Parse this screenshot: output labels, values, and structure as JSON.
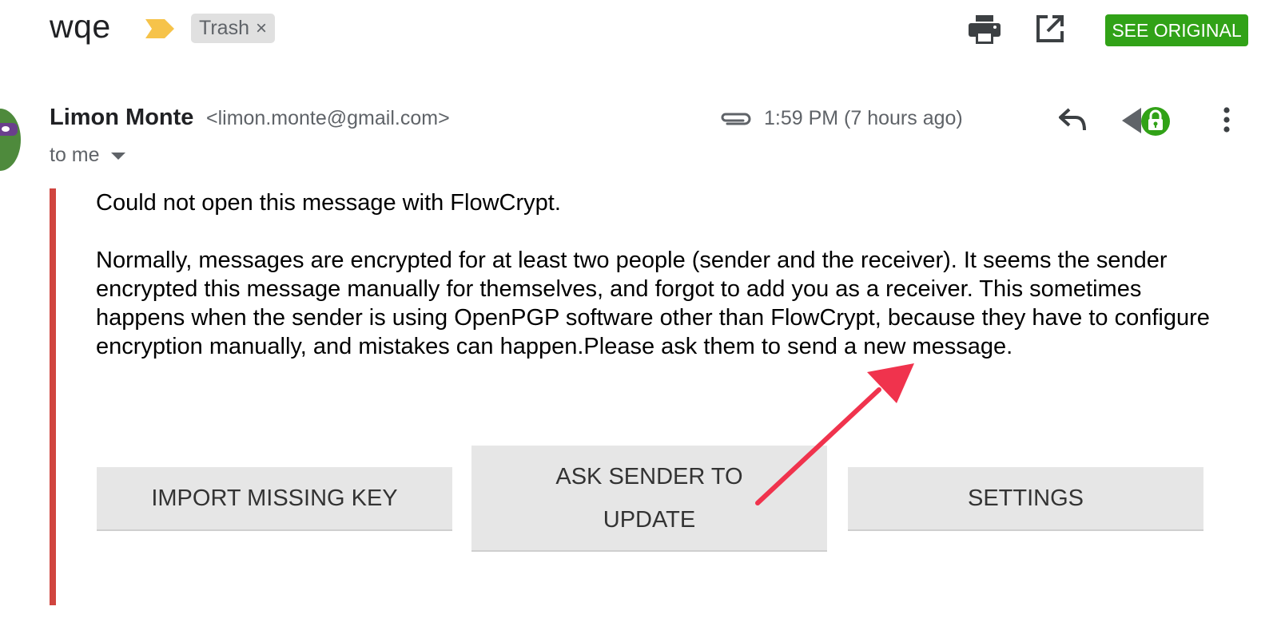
{
  "header": {
    "subject": "wqe",
    "label_chip": "Trash",
    "label_remove": "×",
    "see_original": "SEE ORIGINAL",
    "icons": [
      "importance-marker-icon",
      "print-icon",
      "open-in-new-window-icon"
    ],
    "colors": {
      "see_original_bg": "#31a217",
      "importance": "#f6c34a"
    }
  },
  "sender": {
    "name": "Limon Monte",
    "email": "<limon.monte@gmail.com>",
    "recipient": "to me",
    "timestamp": "1:59 PM (7 hours ago)",
    "icons": [
      "attachment-icon",
      "reply-icon",
      "secure-reply-lock-icon",
      "more-vert-icon"
    ],
    "colors": {
      "lock_badge": "#31a217"
    }
  },
  "message": {
    "title": "Could not open this message with FlowCrypt.",
    "body": "Normally, messages are encrypted for at least two people (sender and the receiver). It seems the sender encrypted this message manually for themselves, and forgot to add you as a receiver. This sometimes happens when the sender is using OpenPGP software other than FlowCrypt, because they have to configure encryption manually, and mistakes can happen.Please ask them to send a new message.",
    "error_bar_color": "#d0453f"
  },
  "buttons": {
    "import": "IMPORT MISSING KEY",
    "ask_sender": "ASK SENDER TO UPDATE",
    "settings": "SETTINGS"
  },
  "annotation": {
    "color": "#f0334d"
  }
}
